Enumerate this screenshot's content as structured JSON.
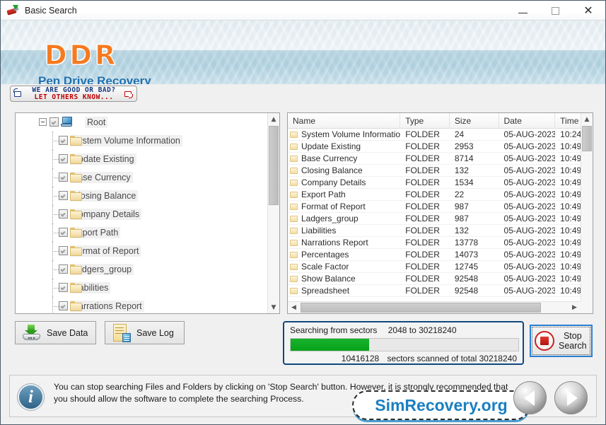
{
  "window": {
    "title": "Basic Search",
    "app_icon": "usb-drive-icon",
    "minimize_label": "",
    "maximize_label": "",
    "close_label": "✕"
  },
  "banner": {
    "logo": "DDR",
    "subtitle": "Pen Drive Recovery"
  },
  "feedback": {
    "line1": "WE ARE GOOD OR BAD?",
    "line2": "LET OTHERS KNOW...",
    "thumb_up_icon": "thumbs-up-icon",
    "thumb_down_icon": "thumbs-down-icon"
  },
  "tree": {
    "root": {
      "label": "Root",
      "icon": "computer-icon",
      "checked": true,
      "expanded": true
    },
    "children": [
      {
        "label": "System Volume Information",
        "checked": true
      },
      {
        "label": "Update Existing",
        "checked": true
      },
      {
        "label": "Base Currency",
        "checked": true
      },
      {
        "label": "Closing Balance",
        "checked": true
      },
      {
        "label": "Company Details",
        "checked": true
      },
      {
        "label": "Export Path",
        "checked": true
      },
      {
        "label": "Format of Report",
        "checked": true
      },
      {
        "label": "Ladgers_group",
        "checked": true
      },
      {
        "label": "Liabilities",
        "checked": true
      },
      {
        "label": "Narrations Report",
        "checked": true
      }
    ]
  },
  "list": {
    "columns": [
      "Name",
      "Type",
      "Size",
      "Date",
      "Time"
    ],
    "rows": [
      {
        "name": "System Volume Information",
        "type": "FOLDER",
        "size": "24",
        "date": "05-AUG-2023",
        "time": "10:24"
      },
      {
        "name": "Update Existing",
        "type": "FOLDER",
        "size": "2953",
        "date": "05-AUG-2023",
        "time": "10:49"
      },
      {
        "name": "Base Currency",
        "type": "FOLDER",
        "size": "8714",
        "date": "05-AUG-2023",
        "time": "10:49"
      },
      {
        "name": "Closing Balance",
        "type": "FOLDER",
        "size": "132",
        "date": "05-AUG-2023",
        "time": "10:49"
      },
      {
        "name": "Company Details",
        "type": "FOLDER",
        "size": "1534",
        "date": "05-AUG-2023",
        "time": "10:49"
      },
      {
        "name": "Export Path",
        "type": "FOLDER",
        "size": "22",
        "date": "05-AUG-2023",
        "time": "10:49"
      },
      {
        "name": "Format of Report",
        "type": "FOLDER",
        "size": "987",
        "date": "05-AUG-2023",
        "time": "10:49"
      },
      {
        "name": "Ladgers_group",
        "type": "FOLDER",
        "size": "987",
        "date": "05-AUG-2023",
        "time": "10:49"
      },
      {
        "name": "Liabilities",
        "type": "FOLDER",
        "size": "132",
        "date": "05-AUG-2023",
        "time": "10:49"
      },
      {
        "name": "Narrations Report",
        "type": "FOLDER",
        "size": "13778",
        "date": "05-AUG-2023",
        "time": "10:49"
      },
      {
        "name": "Percentages",
        "type": "FOLDER",
        "size": "14073",
        "date": "05-AUG-2023",
        "time": "10:49"
      },
      {
        "name": "Scale Factor",
        "type": "FOLDER",
        "size": "12745",
        "date": "05-AUG-2023",
        "time": "10:49"
      },
      {
        "name": "Show Balance",
        "type": "FOLDER",
        "size": "92548",
        "date": "05-AUG-2023",
        "time": "10:49"
      },
      {
        "name": "Spreadsheet",
        "type": "FOLDER",
        "size": "92548",
        "date": "05-AUG-2023",
        "time": "10:49"
      }
    ]
  },
  "actions": {
    "save_data": "Save Data",
    "save_log": "Save Log",
    "stop_search_line1": "Stop",
    "stop_search_line2": "Search"
  },
  "progress": {
    "searching_label": "Searching from sectors",
    "searching_range": "2048 to 30218240",
    "scanned_count": "10416128",
    "scanned_suffix": "sectors scanned of total 30218240",
    "percent": 34.5,
    "fill_color": "#0aa81e",
    "border_color": "#10487f"
  },
  "footer": {
    "info_icon": "info-icon",
    "message": "You can stop searching Files and Folders by clicking on 'Stop Search' button. However, it is strongly recommended that you should allow the software to complete the searching Process.",
    "watermark": "SimRecovery.org",
    "prev_label": "",
    "next_label": ""
  }
}
